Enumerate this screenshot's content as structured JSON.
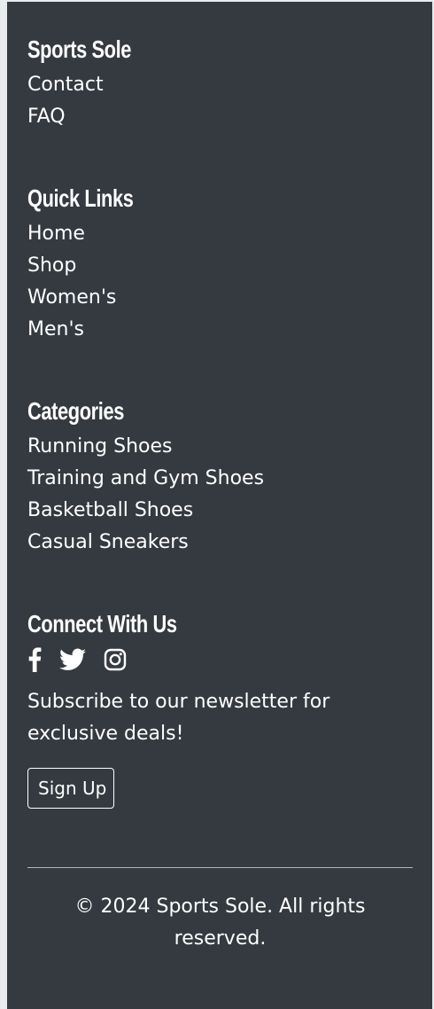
{
  "brand": {
    "heading": "Sports Sole",
    "links": [
      "Contact",
      "FAQ"
    ]
  },
  "quick_links": {
    "heading": "Quick Links",
    "links": [
      "Home",
      "Shop",
      "Women's",
      "Men's"
    ]
  },
  "categories": {
    "heading": "Categories",
    "links": [
      "Running Shoes",
      "Training and Gym Shoes",
      "Basketball Shoes",
      "Casual Sneakers"
    ]
  },
  "connect": {
    "heading": "Connect With Us",
    "icons": [
      "facebook-icon",
      "twitter-icon",
      "instagram-icon"
    ],
    "newsletter_text": "Subscribe to our newsletter for exclusive deals!",
    "signup_label": "Sign Up"
  },
  "copyright": "© 2024 Sports Sole. All rights reserved.",
  "colors": {
    "footer_bg": "#343a40",
    "text": "#ffffff",
    "page_bg": "#e9ecef"
  }
}
